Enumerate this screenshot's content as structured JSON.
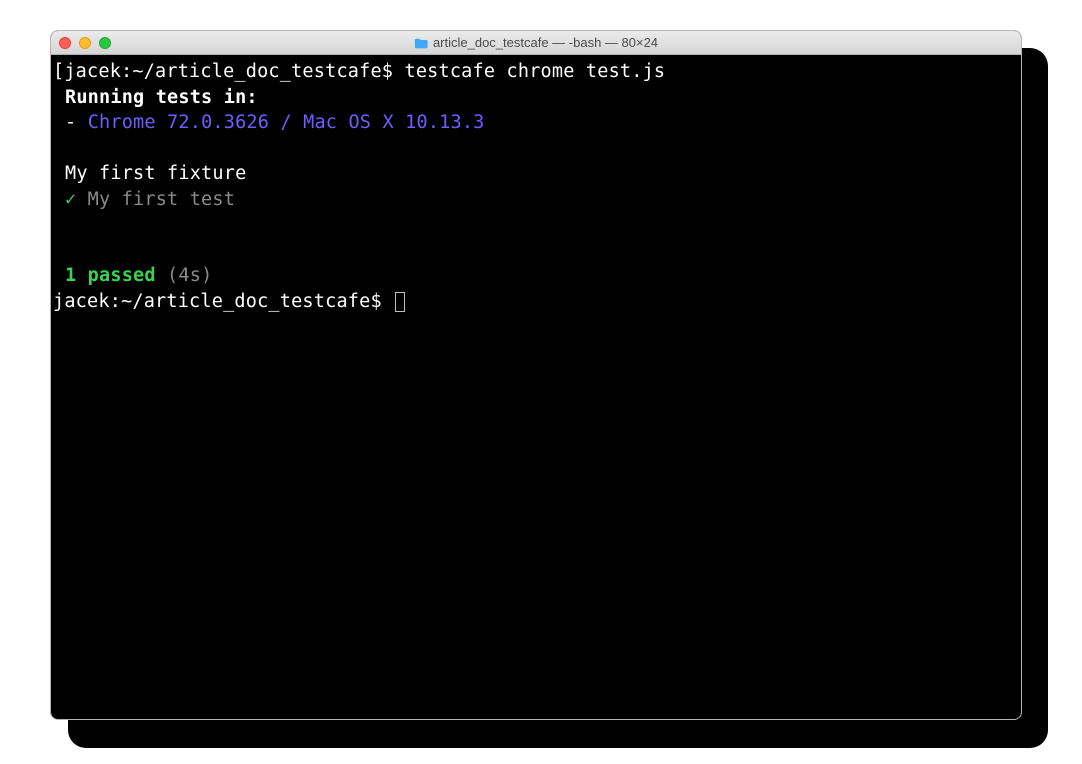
{
  "titlebar": {
    "title": "article_doc_testcafe — -bash — 80×24"
  },
  "terminal": {
    "prompt1_prefix": "[jacek:~/article_doc_testcafe$ ",
    "command": "testcafe chrome test.js",
    "running_label": "Running tests in:",
    "env_dash": "- ",
    "env": "Chrome 72.0.3626 / Mac OS X 10.13.3",
    "fixture": "My first fixture",
    "check": "✓",
    "test_name": " My first test",
    "passed_count": "1",
    "passed_label": " passed",
    "duration": " (4s)",
    "prompt2": "jacek:~/article_doc_testcafe$ "
  }
}
